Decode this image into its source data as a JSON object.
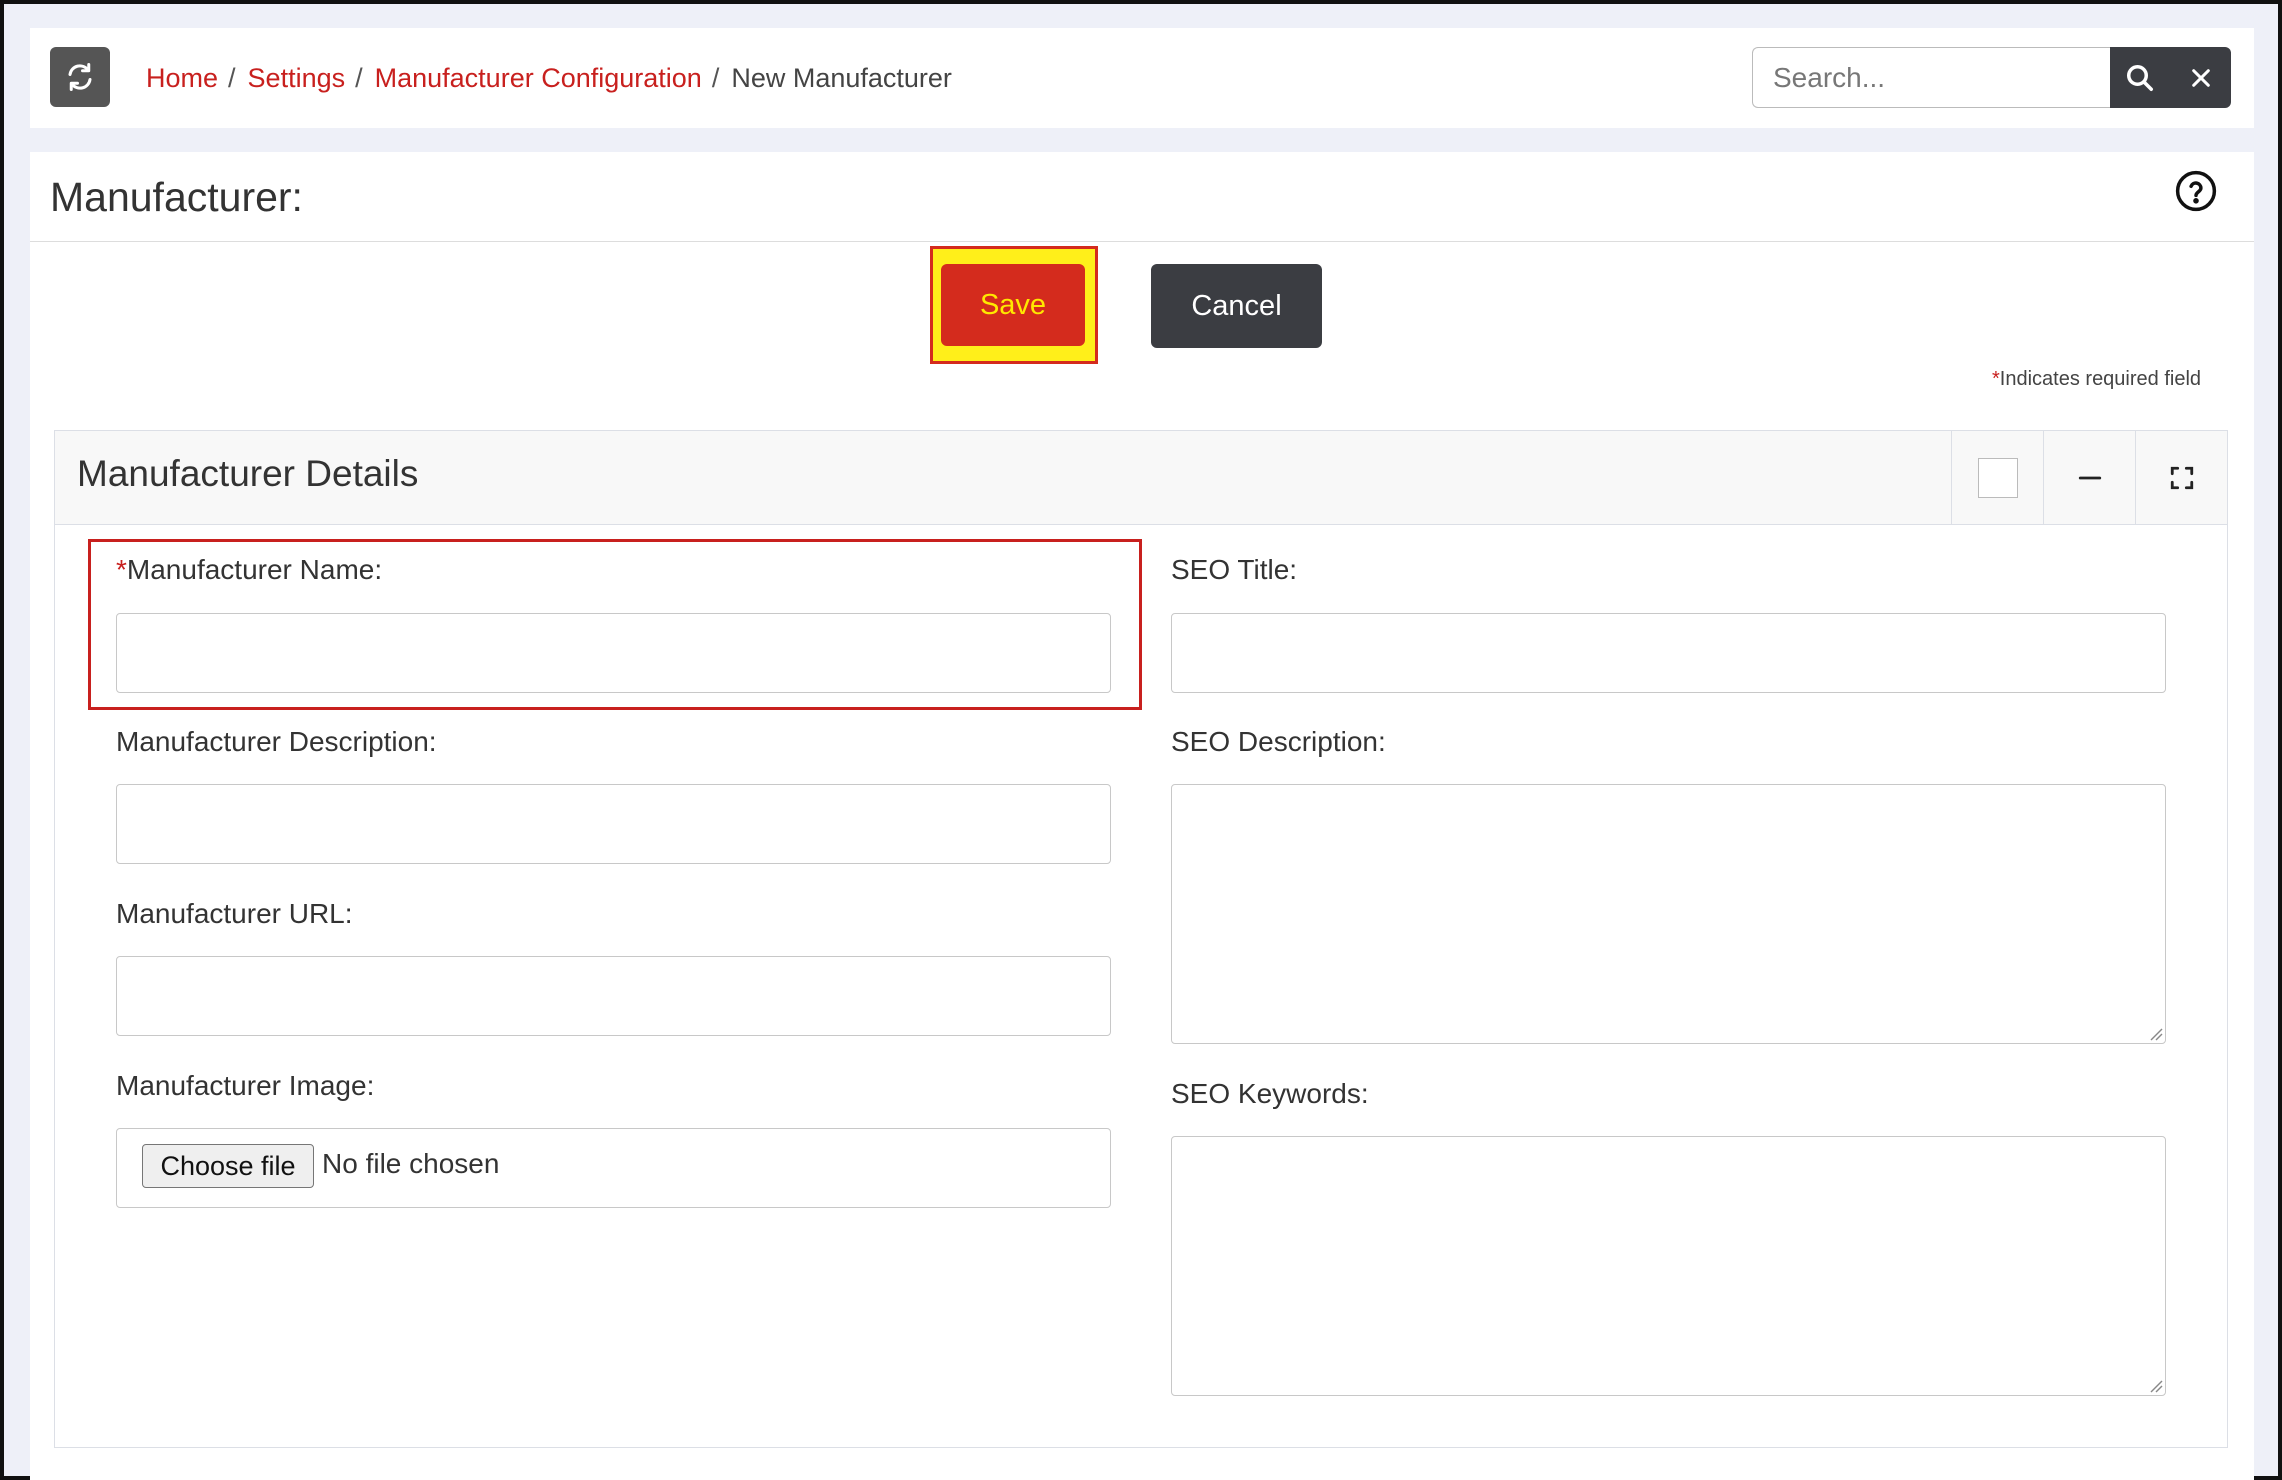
{
  "topbar": {
    "refresh_icon": "refresh-icon",
    "breadcrumb": {
      "home": "Home",
      "settings": "Settings",
      "manufacturer_config": "Manufacturer Configuration",
      "current": "New Manufacturer",
      "separator": "/"
    },
    "search": {
      "placeholder": "Search...",
      "value": "",
      "search_icon": "search-icon",
      "clear_icon": "close-icon"
    }
  },
  "page": {
    "title": "Manufacturer:",
    "help_icon": "help-circle-icon"
  },
  "actions": {
    "save_label": "Save",
    "cancel_label": "Cancel"
  },
  "required_note": {
    "star": "*",
    "text": "Indicates required field"
  },
  "card": {
    "title": "Manufacturer Details",
    "tools": [
      "checkbox",
      "minimize-icon",
      "expand-icon"
    ]
  },
  "form": {
    "name": {
      "star": "*",
      "label": "Manufacturer Name:",
      "value": ""
    },
    "description": {
      "label": "Manufacturer Description:",
      "value": ""
    },
    "url": {
      "label": "Manufacturer URL:",
      "value": ""
    },
    "image": {
      "label": "Manufacturer Image:",
      "button": "Choose file",
      "status": "No file chosen"
    },
    "seo_title": {
      "label": "SEO Title:",
      "value": ""
    },
    "seo_description": {
      "label": "SEO Description:",
      "value": ""
    },
    "seo_keywords": {
      "label": "SEO Keywords:",
      "value": ""
    }
  },
  "colors": {
    "brand_red": "#d42b1d",
    "link_red": "#c8201e",
    "dark_button": "#3b3d42",
    "highlight_yellow": "#ffef1a"
  }
}
